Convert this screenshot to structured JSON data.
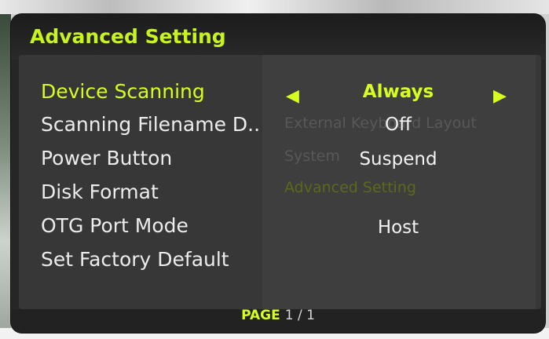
{
  "dialog": {
    "title": "Advanced Setting",
    "items": [
      {
        "label": "Device Scanning",
        "value": "Always"
      },
      {
        "label": "Scanning Filename D..",
        "value": "Off"
      },
      {
        "label": "Power Button",
        "value": "Suspend"
      },
      {
        "label": "Disk Format",
        "value": ""
      },
      {
        "label": "OTG Port Mode",
        "value": "Host"
      },
      {
        "label": "Set Factory Default",
        "value": ""
      }
    ],
    "left_arrow_icon": "triangle-left-icon",
    "right_arrow_icon": "triangle-right-icon",
    "footer": {
      "page_label": "PAGE",
      "page_number": "1 / 1"
    },
    "accent_color": "#d6ff1f"
  },
  "background_menu": [
    "External Keyboard Layout",
    "System",
    "Advanced Setting"
  ]
}
